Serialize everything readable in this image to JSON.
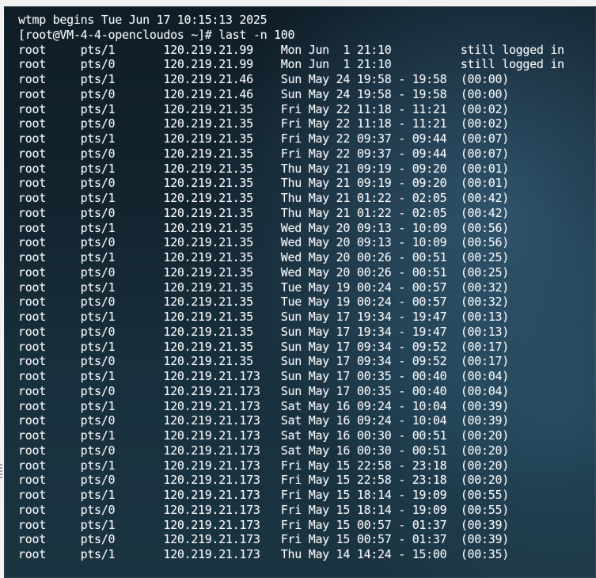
{
  "terminal": {
    "header_line": "wtmp begins Tue Jun 17 10:15:13 2025",
    "prompt": "[root@VM-4-4-opencloudos ~]# last -n 100",
    "rows": [
      {
        "user": "root",
        "tty": "pts/1",
        "host": "120.219.21.99",
        "login": "Mon Jun  1 21:10",
        "sep": " ",
        "logout": "",
        "duration": "still logged in"
      },
      {
        "user": "root",
        "tty": "pts/0",
        "host": "120.219.21.99",
        "login": "Mon Jun  1 21:10",
        "sep": " ",
        "logout": "",
        "duration": "still logged in"
      },
      {
        "user": "root",
        "tty": "pts/1",
        "host": "120.219.21.46",
        "login": "Sun May 24 19:58",
        "sep": "-",
        "logout": "19:58",
        "duration": "(00:00)"
      },
      {
        "user": "root",
        "tty": "pts/0",
        "host": "120.219.21.46",
        "login": "Sun May 24 19:58",
        "sep": "-",
        "logout": "19:58",
        "duration": "(00:00)"
      },
      {
        "user": "root",
        "tty": "pts/1",
        "host": "120.219.21.35",
        "login": "Fri May 22 11:18",
        "sep": "-",
        "logout": "11:21",
        "duration": "(00:02)"
      },
      {
        "user": "root",
        "tty": "pts/0",
        "host": "120.219.21.35",
        "login": "Fri May 22 11:18",
        "sep": "-",
        "logout": "11:21",
        "duration": "(00:02)"
      },
      {
        "user": "root",
        "tty": "pts/1",
        "host": "120.219.21.35",
        "login": "Fri May 22 09:37",
        "sep": "-",
        "logout": "09:44",
        "duration": "(00:07)"
      },
      {
        "user": "root",
        "tty": "pts/0",
        "host": "120.219.21.35",
        "login": "Fri May 22 09:37",
        "sep": "-",
        "logout": "09:44",
        "duration": "(00:07)"
      },
      {
        "user": "root",
        "tty": "pts/1",
        "host": "120.219.21.35",
        "login": "Thu May 21 09:19",
        "sep": "-",
        "logout": "09:20",
        "duration": "(00:01)"
      },
      {
        "user": "root",
        "tty": "pts/0",
        "host": "120.219.21.35",
        "login": "Thu May 21 09:19",
        "sep": "-",
        "logout": "09:20",
        "duration": "(00:01)"
      },
      {
        "user": "root",
        "tty": "pts/1",
        "host": "120.219.21.35",
        "login": "Thu May 21 01:22",
        "sep": "-",
        "logout": "02:05",
        "duration": "(00:42)"
      },
      {
        "user": "root",
        "tty": "pts/0",
        "host": "120.219.21.35",
        "login": "Thu May 21 01:22",
        "sep": "-",
        "logout": "02:05",
        "duration": "(00:42)"
      },
      {
        "user": "root",
        "tty": "pts/1",
        "host": "120.219.21.35",
        "login": "Wed May 20 09:13",
        "sep": "-",
        "logout": "10:09",
        "duration": "(00:56)"
      },
      {
        "user": "root",
        "tty": "pts/0",
        "host": "120.219.21.35",
        "login": "Wed May 20 09:13",
        "sep": "-",
        "logout": "10:09",
        "duration": "(00:56)"
      },
      {
        "user": "root",
        "tty": "pts/1",
        "host": "120.219.21.35",
        "login": "Wed May 20 00:26",
        "sep": "-",
        "logout": "00:51",
        "duration": "(00:25)"
      },
      {
        "user": "root",
        "tty": "pts/0",
        "host": "120.219.21.35",
        "login": "Wed May 20 00:26",
        "sep": "-",
        "logout": "00:51",
        "duration": "(00:25)"
      },
      {
        "user": "root",
        "tty": "pts/1",
        "host": "120.219.21.35",
        "login": "Tue May 19 00:24",
        "sep": "-",
        "logout": "00:57",
        "duration": "(00:32)"
      },
      {
        "user": "root",
        "tty": "pts/0",
        "host": "120.219.21.35",
        "login": "Tue May 19 00:24",
        "sep": "-",
        "logout": "00:57",
        "duration": "(00:32)"
      },
      {
        "user": "root",
        "tty": "pts/1",
        "host": "120.219.21.35",
        "login": "Sun May 17 19:34",
        "sep": "-",
        "logout": "19:47",
        "duration": "(00:13)"
      },
      {
        "user": "root",
        "tty": "pts/0",
        "host": "120.219.21.35",
        "login": "Sun May 17 19:34",
        "sep": "-",
        "logout": "19:47",
        "duration": "(00:13)"
      },
      {
        "user": "root",
        "tty": "pts/1",
        "host": "120.219.21.35",
        "login": "Sun May 17 09:34",
        "sep": "-",
        "logout": "09:52",
        "duration": "(00:17)"
      },
      {
        "user": "root",
        "tty": "pts/0",
        "host": "120.219.21.35",
        "login": "Sun May 17 09:34",
        "sep": "-",
        "logout": "09:52",
        "duration": "(00:17)"
      },
      {
        "user": "root",
        "tty": "pts/1",
        "host": "120.219.21.173",
        "login": "Sun May 17 00:35",
        "sep": "-",
        "logout": "00:40",
        "duration": "(00:04)"
      },
      {
        "user": "root",
        "tty": "pts/0",
        "host": "120.219.21.173",
        "login": "Sun May 17 00:35",
        "sep": "-",
        "logout": "00:40",
        "duration": "(00:04)"
      },
      {
        "user": "root",
        "tty": "pts/1",
        "host": "120.219.21.173",
        "login": "Sat May 16 09:24",
        "sep": "-",
        "logout": "10:04",
        "duration": "(00:39)"
      },
      {
        "user": "root",
        "tty": "pts/0",
        "host": "120.219.21.173",
        "login": "Sat May 16 09:24",
        "sep": "-",
        "logout": "10:04",
        "duration": "(00:39)"
      },
      {
        "user": "root",
        "tty": "pts/1",
        "host": "120.219.21.173",
        "login": "Sat May 16 00:30",
        "sep": "-",
        "logout": "00:51",
        "duration": "(00:20)"
      },
      {
        "user": "root",
        "tty": "pts/0",
        "host": "120.219.21.173",
        "login": "Sat May 16 00:30",
        "sep": "-",
        "logout": "00:51",
        "duration": "(00:20)"
      },
      {
        "user": "root",
        "tty": "pts/1",
        "host": "120.219.21.173",
        "login": "Fri May 15 22:58",
        "sep": "-",
        "logout": "23:18",
        "duration": "(00:20)"
      },
      {
        "user": "root",
        "tty": "pts/0",
        "host": "120.219.21.173",
        "login": "Fri May 15 22:58",
        "sep": "-",
        "logout": "23:18",
        "duration": "(00:20)"
      },
      {
        "user": "root",
        "tty": "pts/1",
        "host": "120.219.21.173",
        "login": "Fri May 15 18:14",
        "sep": "-",
        "logout": "19:09",
        "duration": "(00:55)"
      },
      {
        "user": "root",
        "tty": "pts/0",
        "host": "120.219.21.173",
        "login": "Fri May 15 18:14",
        "sep": "-",
        "logout": "19:09",
        "duration": "(00:55)"
      },
      {
        "user": "root",
        "tty": "pts/1",
        "host": "120.219.21.173",
        "login": "Fri May 15 00:57",
        "sep": "-",
        "logout": "01:37",
        "duration": "(00:39)"
      },
      {
        "user": "root",
        "tty": "pts/0",
        "host": "120.219.21.173",
        "login": "Fri May 15 00:57",
        "sep": "-",
        "logout": "01:37",
        "duration": "(00:39)"
      },
      {
        "user": "root",
        "tty": "pts/1",
        "host": "120.219.21.173",
        "login": "Thu May 14 14:24",
        "sep": "-",
        "logout": "15:00",
        "duration": "(00:35)"
      }
    ]
  }
}
